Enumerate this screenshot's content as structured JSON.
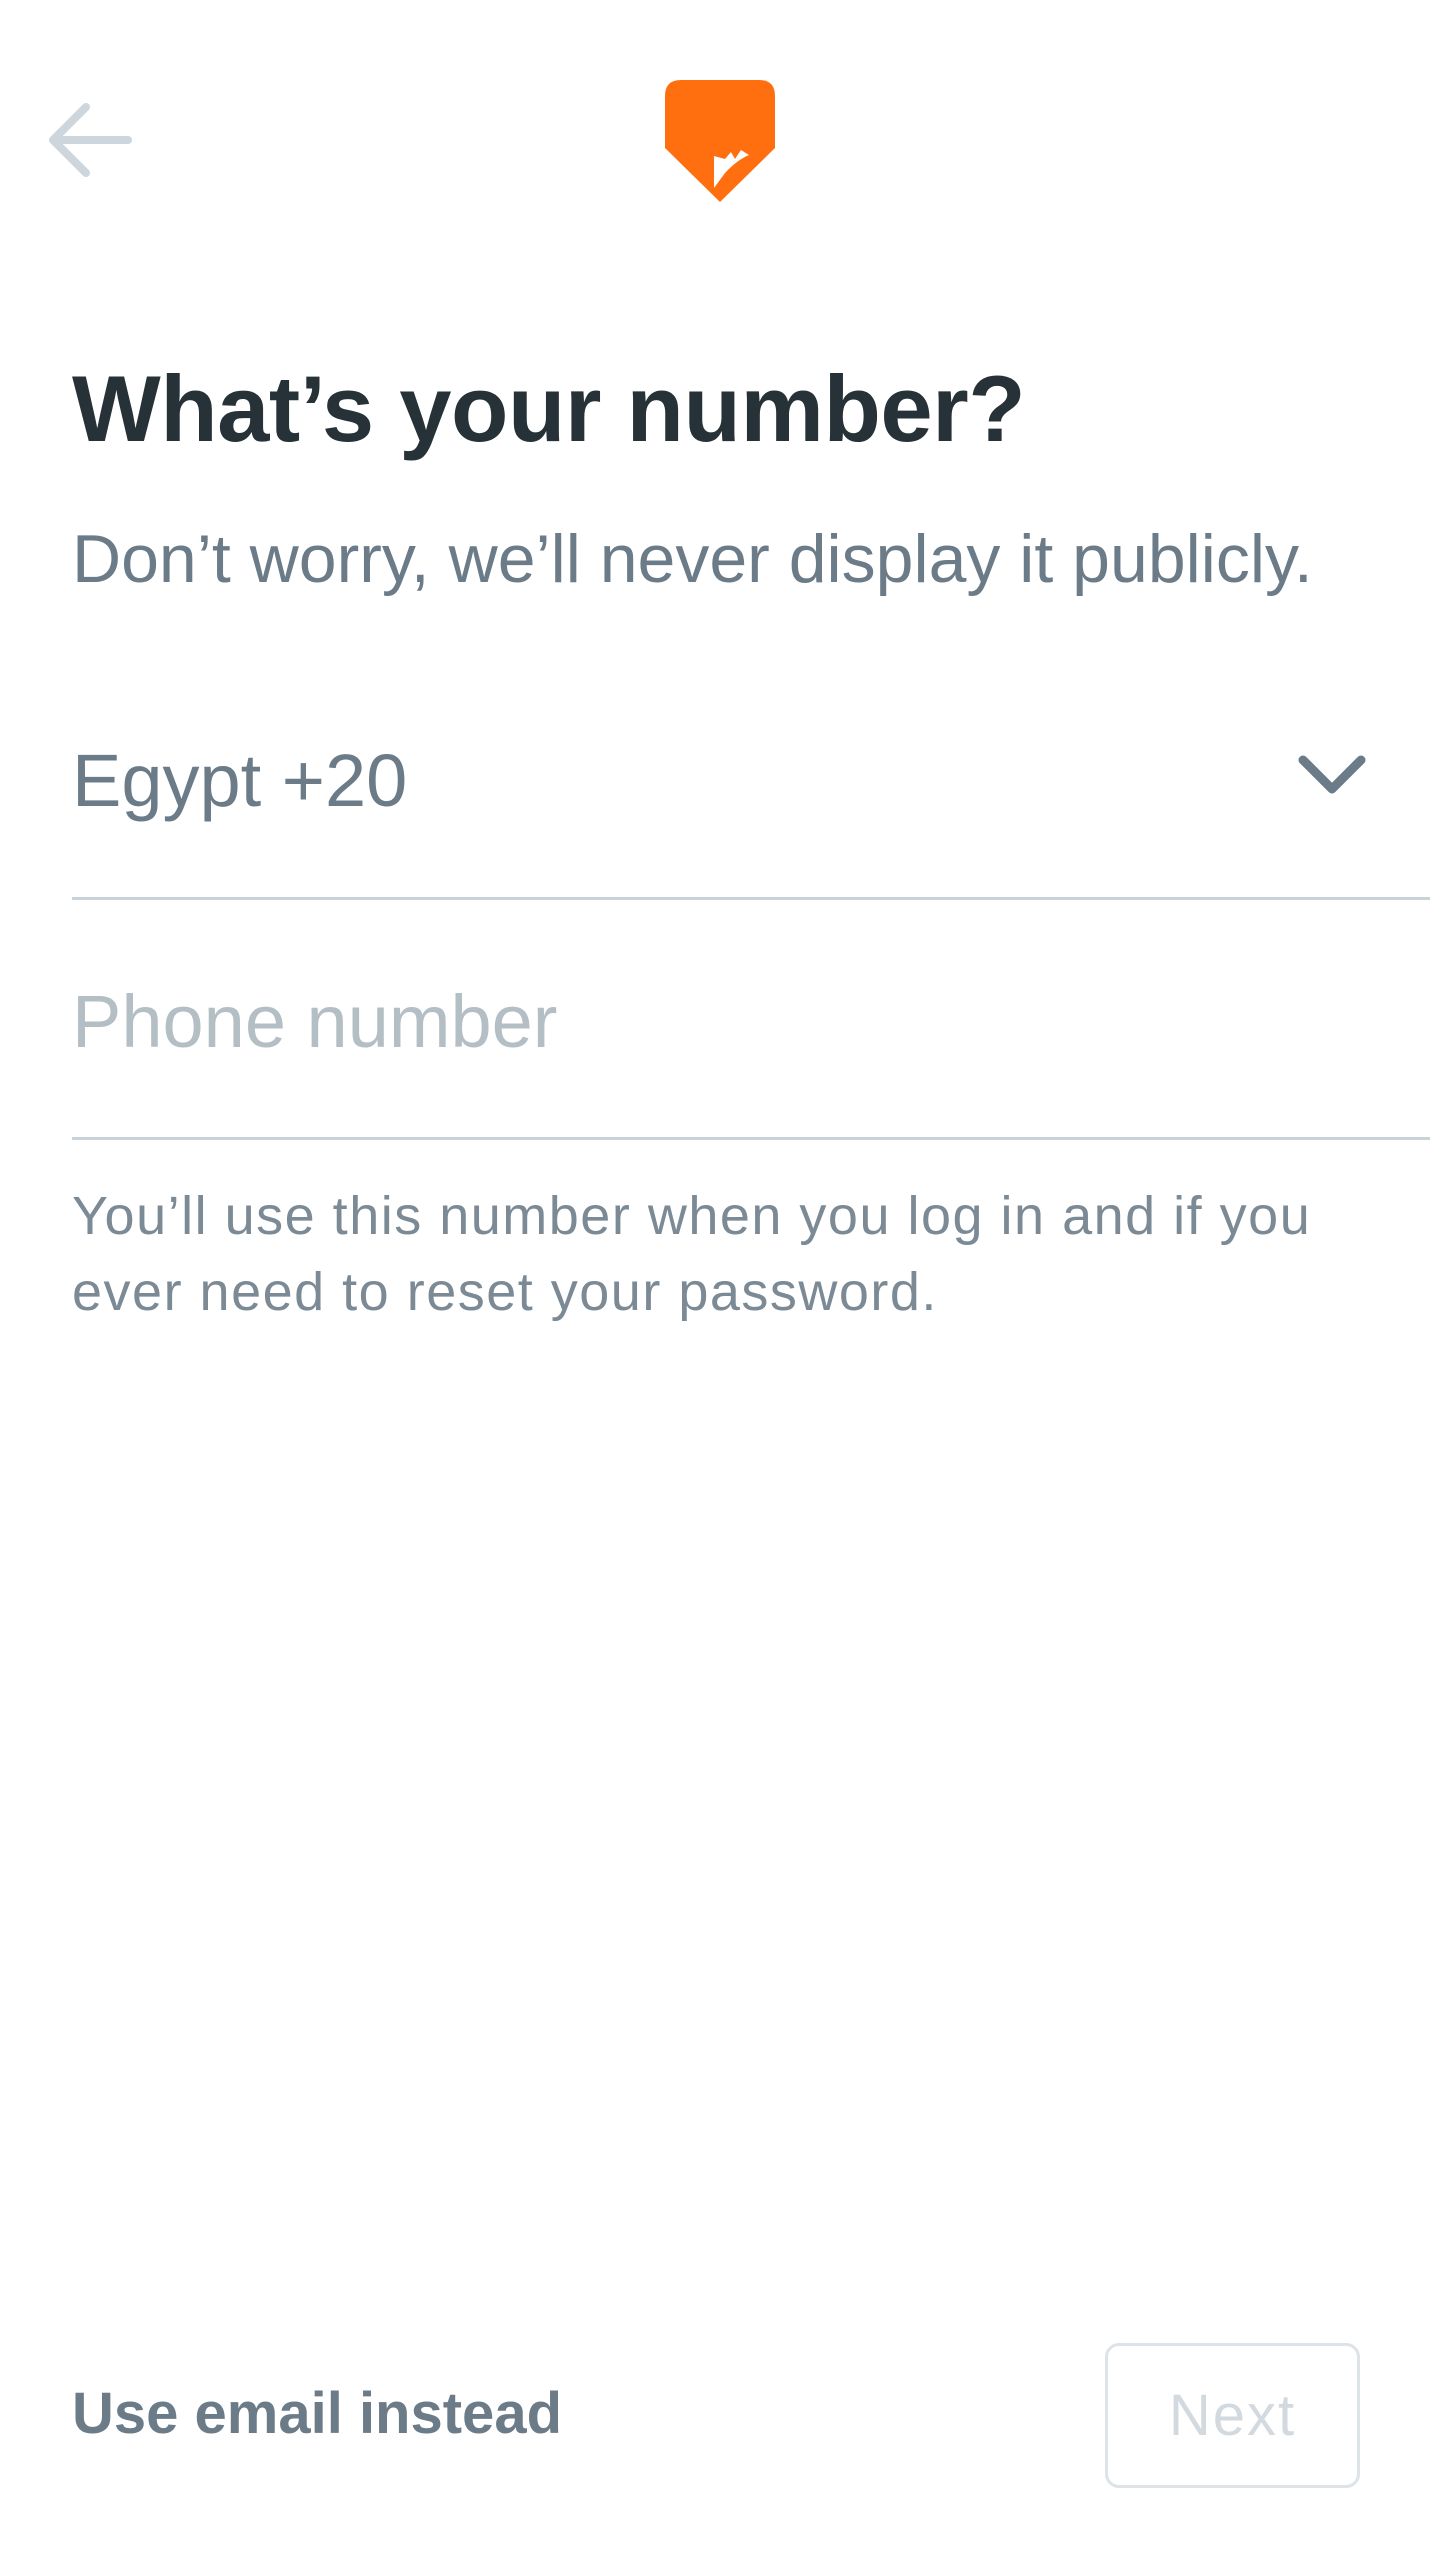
{
  "header": {
    "back_icon": "arrow-left-icon",
    "logo_icon": "brand-logo-icon",
    "brand_color": "#FF6F0F"
  },
  "main": {
    "title": "What’s your number?",
    "subtitle": "Don’t worry, we’ll never display it publicly.",
    "country_select": {
      "value": "Egypt +20",
      "icon": "chevron-down-icon"
    },
    "phone_input": {
      "value": "",
      "placeholder": "Phone number"
    },
    "helper_text": "You’ll use this number when you log in and if you ever need to reset your password."
  },
  "footer": {
    "email_link_label": "Use email instead",
    "next_label": "Next"
  }
}
